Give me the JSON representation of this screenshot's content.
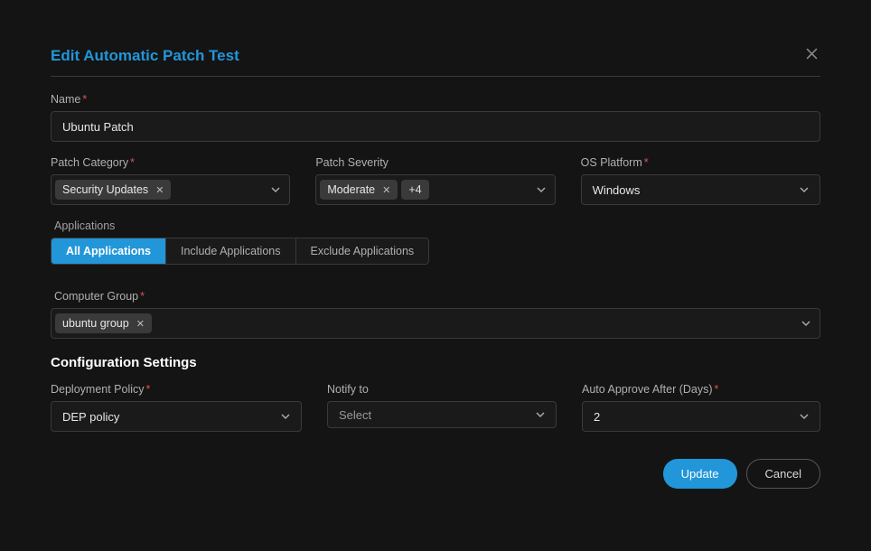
{
  "header": {
    "title": "Edit Automatic Patch Test"
  },
  "fields": {
    "name": {
      "label": "Name",
      "value": "Ubuntu Patch"
    },
    "patch_category": {
      "label": "Patch Category",
      "tag": "Security Updates"
    },
    "patch_severity": {
      "label": "Patch Severity",
      "tag": "Moderate",
      "more": "+4"
    },
    "os_platform": {
      "label": "OS Platform",
      "value": "Windows"
    },
    "applications": {
      "label": "Applications"
    },
    "computer_group": {
      "label": "Computer Group",
      "tag": "ubuntu group"
    }
  },
  "tabs": {
    "all": "All Applications",
    "include": "Include Applications",
    "exclude": "Exclude Applications"
  },
  "config": {
    "section_title": "Configuration Settings",
    "deployment_policy": {
      "label": "Deployment Policy",
      "value": "DEP policy"
    },
    "notify_to": {
      "label": "Notify to",
      "value": "Select"
    },
    "auto_approve": {
      "label": "Auto Approve After (Days)",
      "value": "2"
    }
  },
  "actions": {
    "update": "Update",
    "cancel": "Cancel"
  }
}
